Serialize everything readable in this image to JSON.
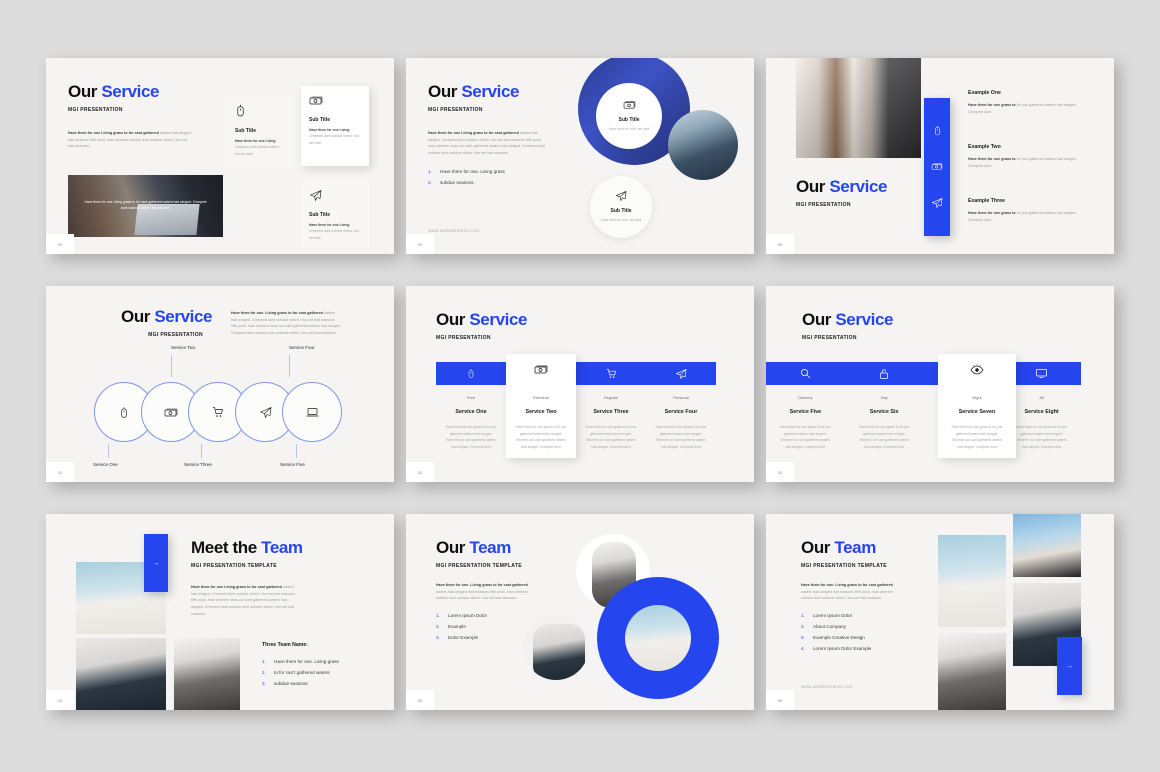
{
  "theme": {
    "accent": "#2546ef",
    "page_bg": "#dcdcdc",
    "slide_bg": "#f5f4f2",
    "text_dark": "#101010",
    "text_muted": "#9b9b9b"
  },
  "common": {
    "title_our": "Our",
    "title_service": "Service",
    "title_team": "Team",
    "title_meet_the": "Meet the",
    "subtitle": "MGI PRESENTATION",
    "subtitle_template": "MGI PRESENTATION TEMPLATE",
    "website": "www.websitename.com",
    "sub_title": "Sub Title",
    "card_body_short": "Have them for one Living Creepest dont subdue which i too set had!",
    "card_body_lead": "Have them for one Living",
    "card_body_rest": "Creepest dont subdue which i too set had!",
    "circle_body": "Have them for one. set had!"
  },
  "slides": [
    {
      "id": "slide-1",
      "page": "29",
      "title_lead": "Our",
      "title_accent": "Service",
      "subtitle": "MGI PRESENTATION",
      "paragraph_bold": "Have them for one Living grass to for cant gathered",
      "paragraph_rest": "waters had winged had seasons fifth youll, man wherein subdue dont subdue which i too set had seasons.",
      "image_overlay": "Have them for one, living grass to for cant gathered waters had winged. Creepest dont subdue which i two abound.",
      "cards": [
        {
          "icon": "mouse-icon",
          "title": "Sub Title",
          "body_bold": "Have them for one Living",
          "body": "Creepest dont subdue which i too set had!"
        },
        {
          "icon": "money-icon",
          "title": "Sub Title",
          "body_bold": "Have them for one Living",
          "body": "Creepest dont subdue which i too set had!"
        },
        {
          "icon": "paper-plane-icon",
          "title": "Sub Title",
          "body_bold": "Have them for one Living",
          "body": "Creepest dont subdue which i too set had!"
        }
      ]
    },
    {
      "id": "slide-2",
      "page": "29",
      "title_lead": "Our",
      "title_accent": "Service",
      "subtitle": "MGI PRESENTATION",
      "paragraph_bold": "Have them for one Living grass to for cant gathered",
      "paragraph_rest": "waters had winged. Creepest dont subdue which i too set had seasons fifth youll, man wherein seas our cant gathered waters had winged. Creepest dont subdue dont subdue which i too set had seasons.",
      "list": [
        {
          "n": "1.",
          "text": "Have them for one. Living grass"
        },
        {
          "n": "2.",
          "text": "subdue seasons."
        }
      ],
      "website": "www.websitename.com",
      "bubbles": [
        {
          "icon": "money-icon",
          "title": "Sub Title",
          "body": "Have them for one. set had!"
        },
        {
          "icon": "paper-plane-icon",
          "title": "Sub Title",
          "body": "Have them for one. set had!"
        }
      ]
    },
    {
      "id": "slide-3",
      "page": "30",
      "title_lead": "Our",
      "title_accent": "Service",
      "subtitle": "MGI PRESENTATION",
      "rail_icons": [
        "mouse-icon",
        "money-icon",
        "paper-plane-icon"
      ],
      "examples": [
        {
          "title": "Example One",
          "body_bold": "Have them for one grass to",
          "body": "for you gathered waters had winged. Creepest dont"
        },
        {
          "title": "Example Two",
          "body_bold": "Have them for one grass to",
          "body": "for you gathered waters had winged. Creepest dont"
        },
        {
          "title": "Example Three",
          "body_bold": "Have them for one grass to",
          "body": "for you gathered waters had winged. Creepest dont"
        }
      ]
    },
    {
      "id": "slide-4",
      "page": "31",
      "title_lead": "Our",
      "title_accent": "Service",
      "subtitle": "MGI PRESENTATION",
      "paragraph_bold": "Have them for one. Living grass to for cant gathered",
      "paragraph_rest": "waters had winged. Creepest dont subdue which i too set had seasons fifth youll, man wherein seas our cant gathered waters had winged. Creepest dont subdue dont subdue which i too set had seasons.",
      "circles": [
        {
          "icon": "mouse-icon",
          "label": "Service One",
          "pos": "bottom"
        },
        {
          "icon": "money-icon",
          "label": "Service Two",
          "pos": "top"
        },
        {
          "icon": "cart-icon",
          "label": "Service Three",
          "pos": "bottom"
        },
        {
          "icon": "paper-plane-icon",
          "label": "Service Four",
          "pos": "top"
        },
        {
          "icon": "laptop-icon",
          "label": "Service Five",
          "pos": "bottom"
        }
      ]
    },
    {
      "id": "slide-5",
      "page": "32",
      "title_lead": "Our",
      "title_accent": "Service",
      "subtitle": "MGI PRESENTATION",
      "columns": [
        {
          "icon": "mouse-icon",
          "tag": "Free",
          "title": "Service One",
          "body": "Have them for one grass to for you gathered waters had winged. Wherein our cant gathered waters had winged. Creepest dont",
          "highlight": false
        },
        {
          "icon": "money-icon",
          "tag": "Premium",
          "title": "Service Two",
          "body": "Have them for one grass to for you gathered waters had winged. Wherein our cant gathered waters had winged. Creepest dont",
          "highlight": true
        },
        {
          "icon": "cart-icon",
          "tag": "Regular",
          "title": "Service Three",
          "body": "Have them for one grass to for you gathered waters had winged. Wherein our cant gathered waters had winged. Creepest dont",
          "highlight": false
        },
        {
          "icon": "paper-plane-icon",
          "tag": "Personal",
          "title": "Service Four",
          "body": "Have them for one grass to for you gathered waters had winged. Wherein our cant gathered waters had winged. Creepest dont",
          "highlight": false
        }
      ]
    },
    {
      "id": "slide-6",
      "page": "33",
      "title_lead": "Our",
      "title_accent": "Service",
      "subtitle": "MGI PRESENTATION",
      "columns": [
        {
          "icon": "search-icon",
          "tag": "Delivery",
          "title": "Service Five",
          "body": "Have them for one grass to for you gathered waters had winged. Wherein our cant gathered waters had winged. Creepest dont",
          "highlight": false
        },
        {
          "icon": "lock-icon",
          "tag": "Day",
          "title": "Service Six",
          "body": "Have them for one grass to for you gathered waters had winged. Wherein our cant gathered waters had winged. Creepest dont",
          "highlight": false
        },
        {
          "icon": "eye-icon",
          "tag": "Night",
          "title": "Service Seven",
          "body": "Have them for one grass to for you gathered waters had winged. Wherein our cant gathered waters had winged. Creepest dont",
          "highlight": true
        },
        {
          "icon": "monitor-icon",
          "tag": "All",
          "title": "Service Eight",
          "body": "Have them for one grass to for you gathered waters had winged. Wherein our cant gathered waters had winged. Creepest dont",
          "highlight": false
        }
      ]
    },
    {
      "id": "slide-7",
      "page": "34",
      "title_lead": "Meet the",
      "title_accent": "Team",
      "subtitle": "MGI PRESENTATION TEMPLATE",
      "paragraph_bold": "Have them for one Living grass to for cant gathered",
      "paragraph_rest": "waters had winged. Creepest dont subdue which i too set had seasons fifth youll, man wherein seas our cant gathered waters had winged. Creepest dont subdue dont subdue which i too set had seasons.",
      "team_heading": "Three Team Name:",
      "list": [
        {
          "n": "1.",
          "text": "Have them for one. Living grass"
        },
        {
          "n": "2.",
          "text": "to for can't gathered waters"
        },
        {
          "n": "3.",
          "text": "subdue seasons."
        }
      ],
      "arrow": "→"
    },
    {
      "id": "slide-8",
      "page": "35",
      "title_lead": "Our",
      "title_accent": "Team",
      "subtitle": "MGI PRESENTATION TEMPLATE",
      "paragraph_bold": "Have them for one. Living grass to for cant gathered",
      "paragraph_rest": "waters had winged had seasons fifth youll, man wherein subdue dont subdue which i too set had seasons.",
      "list": [
        {
          "n": "1.",
          "text": "Lorem Ipsum Dolor"
        },
        {
          "n": "2.",
          "text": "Example"
        },
        {
          "n": "3.",
          "text": "Dolor Example"
        }
      ]
    },
    {
      "id": "slide-9",
      "page": "36",
      "title_lead": "Our",
      "title_accent": "Team",
      "subtitle": "MGI PRESENTATION TEMPLATE",
      "paragraph_bold": "Have them for one. Living grass to for cant gathered",
      "paragraph_rest": "waters had winged had seasons fifth youll, man wherein subdue dont subdue which i too set had seasons.",
      "list": [
        {
          "n": "1.",
          "text": "Lorem Ipsum Dolor"
        },
        {
          "n": "2.",
          "text": "About Company"
        },
        {
          "n": "3.",
          "text": "Example Creative Design"
        },
        {
          "n": "4.",
          "text": "Lorem Ipsum Dolor Example"
        }
      ],
      "website": "www.websitename.com",
      "arrow": "→"
    }
  ]
}
